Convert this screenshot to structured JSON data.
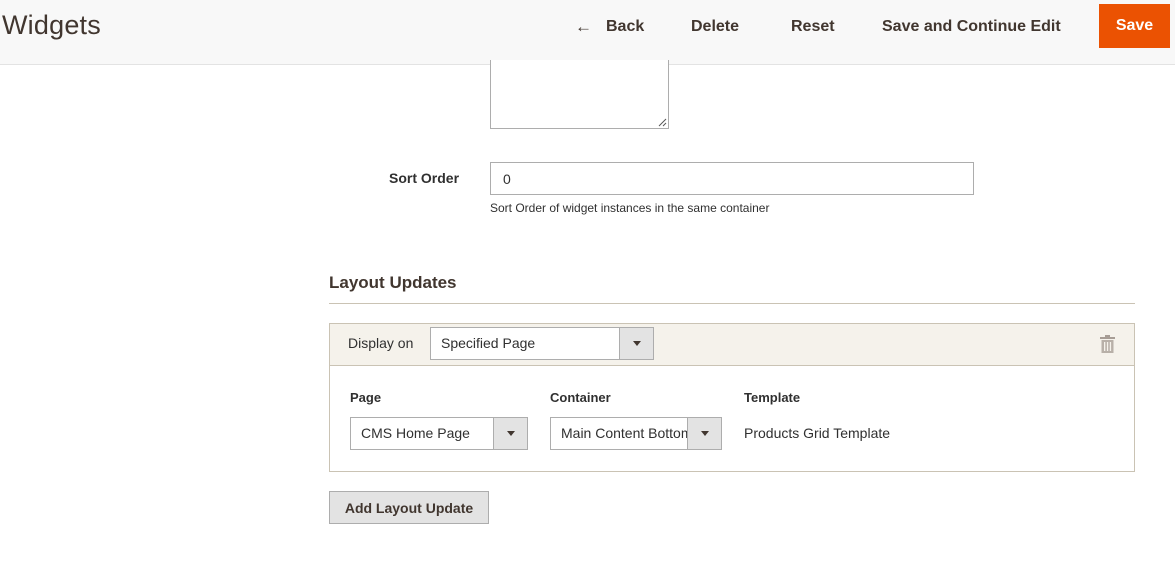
{
  "header": {
    "title": "Widgets",
    "actions": {
      "back_label": "Back",
      "back_icon": "arrow-left-icon",
      "delete_label": "Delete",
      "reset_label": "Reset",
      "save_continue_label": "Save and Continue Edit",
      "save_label": "Save"
    }
  },
  "form": {
    "textarea": {
      "value": ""
    },
    "sort_order": {
      "label": "Sort Order",
      "value": "0",
      "note": "Sort Order of widget instances in the same container"
    }
  },
  "layout_updates": {
    "title": "Layout Updates",
    "items": [
      {
        "display_on_label": "Display on",
        "display_on_value": "Specified Page",
        "delete_icon": "trash-icon",
        "page_label": "Page",
        "page_value": "CMS Home Page",
        "container_label": "Container",
        "container_value": "Main Content Bottom",
        "template_label": "Template",
        "template_value": "Products Grid Template"
      }
    ],
    "add_button_label": "Add Layout Update"
  },
  "colors": {
    "accent": "#eb5202",
    "header_bg": "#f8f8f8",
    "panel_head_bg": "#f5f2eb",
    "border": "#cac3b4"
  }
}
